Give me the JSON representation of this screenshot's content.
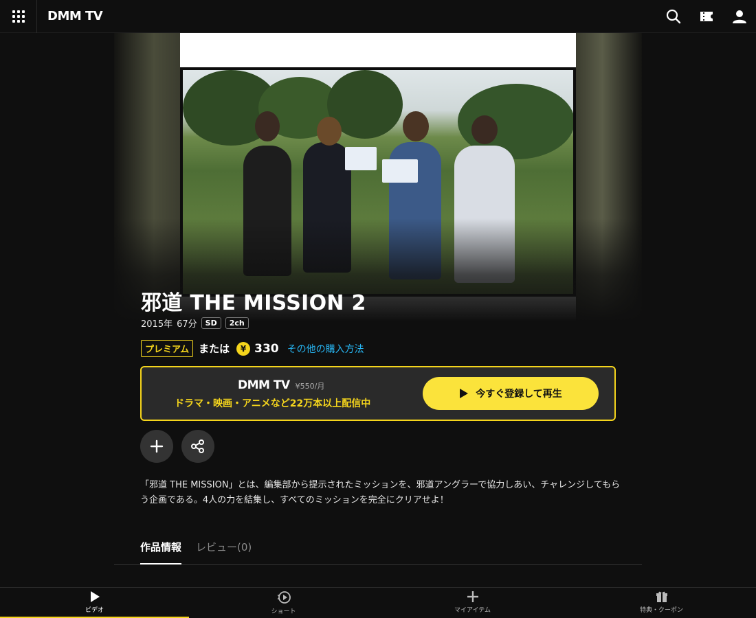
{
  "header": {
    "logo": "DMM TV",
    "icons": [
      "menu-grid-icon",
      "search-icon",
      "ticket-icon",
      "user-icon"
    ]
  },
  "title": {
    "main": "邪道 THE MISSION 2",
    "year": "2015年",
    "duration": "67分",
    "badges": [
      "SD",
      "2ch"
    ]
  },
  "pricing": {
    "premium_label": "プレミアム",
    "or_text": "または",
    "yen_symbol": "¥",
    "price": "330",
    "other_purchase": "その他の購入方法"
  },
  "promo": {
    "brand": "DMM TV",
    "monthly": "¥550/月",
    "tagline": "ドラマ・映画・アニメなど22万本以上配信中",
    "cta": "今すぐ登録して再生"
  },
  "actions": {
    "add_icon": "plus-icon",
    "share_icon": "share-icon"
  },
  "description": "「邪道 THE MISSION」とは、編集部から提示されたミッションを、邪道アングラーで協力しあい、チャレンジしてもらう企画である。4人の力を結集し、すべてのミッションを完全にクリアせよ！",
  "tabs": [
    {
      "label": "作品情報",
      "active": true
    },
    {
      "label": "レビュー(0)",
      "active": false
    }
  ],
  "bottom_nav": [
    {
      "label": "ビデオ",
      "icon": "play-icon",
      "active": true
    },
    {
      "label": "ショート",
      "icon": "short-video-icon",
      "active": false
    },
    {
      "label": "マイアイテム",
      "icon": "plus-icon",
      "active": false
    },
    {
      "label": "特典・クーポン",
      "icon": "gift-icon",
      "active": false
    }
  ],
  "colors": {
    "accent_yellow": "#f5d51c",
    "link_blue": "#27b7f5",
    "background": "#0f0f0f"
  }
}
